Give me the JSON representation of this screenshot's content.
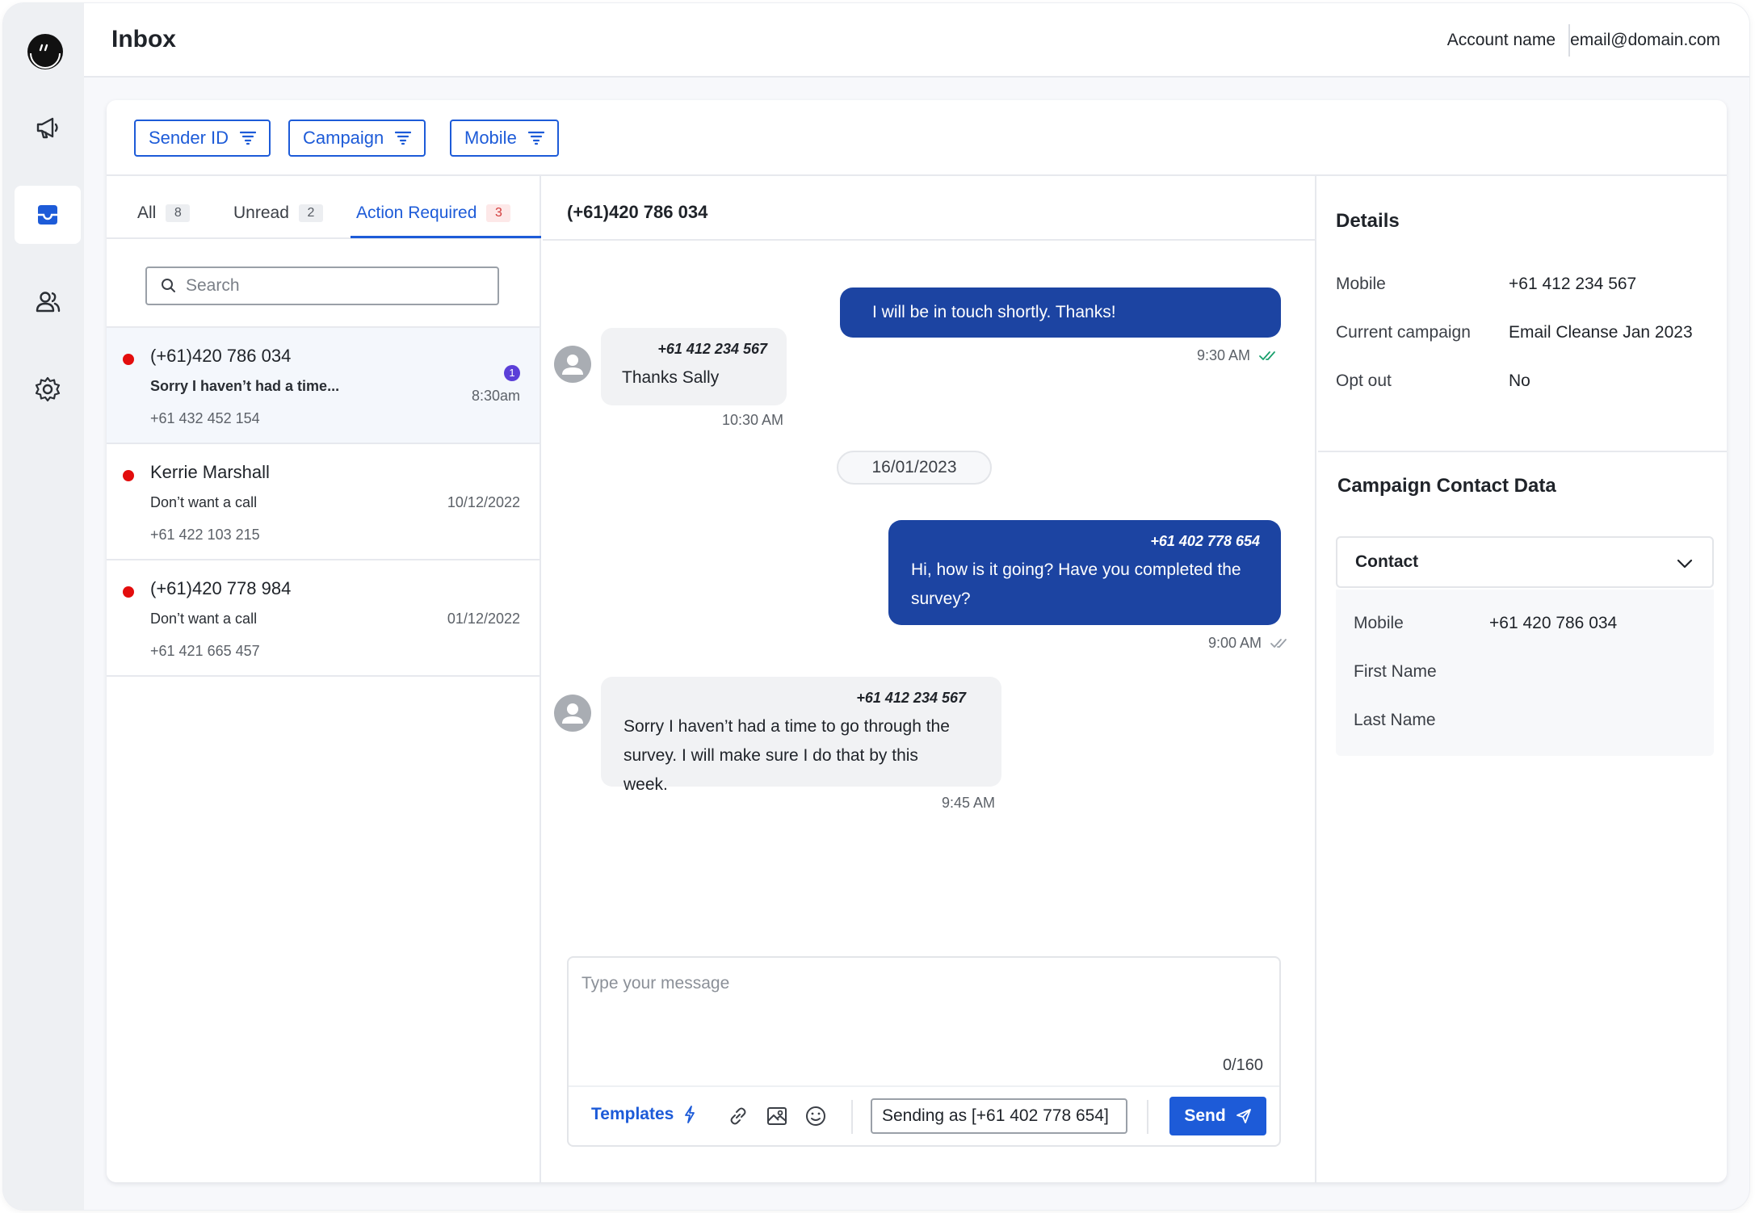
{
  "header": {
    "title": "Inbox",
    "account_name": "Account name",
    "account_email": "email@domain.com"
  },
  "rail": {
    "items": [
      {
        "icon": "megaphone-icon",
        "active": false
      },
      {
        "icon": "inbox-icon",
        "active": true
      },
      {
        "icon": "users-icon",
        "active": false
      },
      {
        "icon": "gear-icon",
        "active": false
      }
    ]
  },
  "filters": [
    {
      "label": "Sender ID",
      "icon": "filter-icon"
    },
    {
      "label": "Campaign",
      "icon": "filter-icon"
    },
    {
      "label": "Mobile",
      "icon": "filter-icon"
    }
  ],
  "tabs": [
    {
      "label": "All",
      "count": "8"
    },
    {
      "label": "Unread",
      "count": "2"
    },
    {
      "label": "Action Required",
      "count": "3",
      "active": true
    }
  ],
  "search": {
    "placeholder": "Search"
  },
  "conversations": [
    {
      "name": "(+61)420 786 034",
      "preview": "Sorry I haven’t had a time...",
      "phone": "+61 432 452 154",
      "date": "8:30am",
      "unread": "1",
      "selected": true
    },
    {
      "name": "Kerrie Marshall",
      "preview": "Don’t want a call",
      "phone": "+61 422 103 215",
      "date": "10/12/2022"
    },
    {
      "name": "(+61)420 778 984",
      "preview": "Don’t want a call",
      "phone": "+61 421 665 457",
      "date": "01/12/2022"
    }
  ],
  "chat": {
    "title": "(+61)420 786 034",
    "messages": [
      {
        "direction": "out",
        "text": "I will be in touch shortly. Thanks!",
        "time": "9:30 AM",
        "status": "read"
      },
      {
        "direction": "in",
        "sender": "+61 412 234 567",
        "text": "Thanks Sally",
        "time": "10:30 AM"
      },
      {
        "direction": "out",
        "sender": "+61 402 778 654",
        "text_line1": "Hi, how is it going? Have you completed the",
        "text_line2": "survey?",
        "time": "9:00 AM",
        "status": "sent"
      },
      {
        "direction": "in",
        "sender": "+61 412 234 567",
        "text_line1": "Sorry I haven’t had a time to go through the",
        "text_line2": "survey. I will make sure I do that by this week.",
        "time": "9:45 AM"
      }
    ],
    "date_divider": "16/01/2023"
  },
  "composer": {
    "placeholder": "Type your message",
    "char_count": "0/160",
    "templates_label": "Templates",
    "sending_as": "Sending as [+61 402 778 654]",
    "send_label": "Send"
  },
  "details": {
    "title": "Details",
    "rows": [
      {
        "label": "Mobile",
        "value": "+61 412 234 567"
      },
      {
        "label": "Current campaign",
        "value": "Email Cleanse Jan 2023"
      },
      {
        "label": "Opt out",
        "value": "No"
      }
    ]
  },
  "campaign_contact": {
    "title": "Campaign Contact Data",
    "select_label": "Contact",
    "rows": [
      {
        "label": "Mobile",
        "value": "+61 420 786 034"
      },
      {
        "label": "First Name",
        "value": ""
      },
      {
        "label": "Last Name",
        "value": ""
      }
    ]
  },
  "colors": {
    "accent": "#1d5bd8",
    "bubble_out": "#1c44a2",
    "bubble_in": "#f1f2f4",
    "unread_dot": "#e30d0d",
    "read_check": "#1aa06d"
  }
}
